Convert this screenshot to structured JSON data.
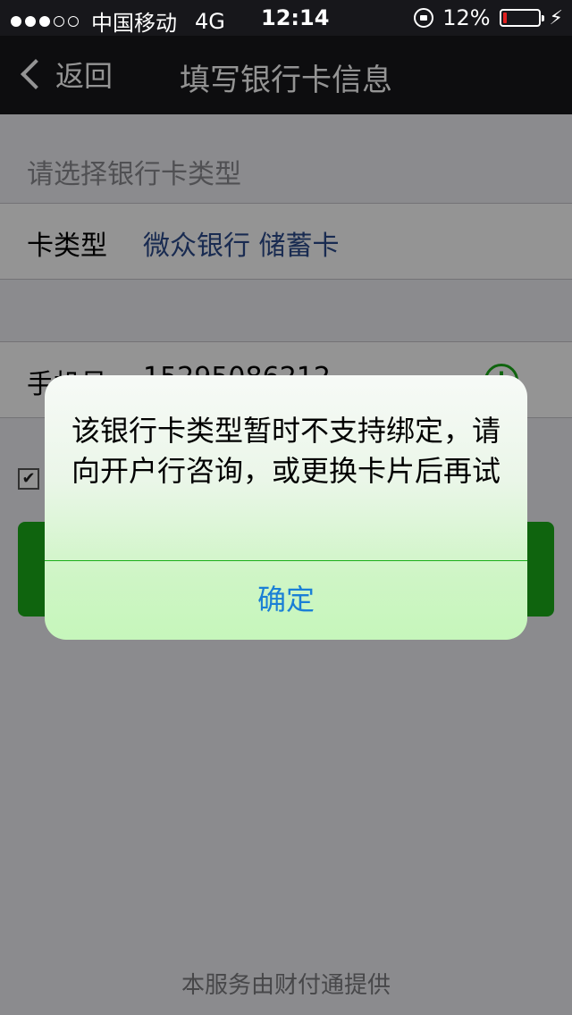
{
  "status_bar": {
    "carrier": "中国移动",
    "network": "4G",
    "time": "12:14",
    "battery_percent": "12%",
    "battery_level": 0.12,
    "signal_bars_filled": 3,
    "signal_bars_total": 5
  },
  "nav": {
    "back_label": "返回",
    "title": "填写银行卡信息"
  },
  "form": {
    "section_hint": "请选择银行卡类型",
    "card_type_label": "卡类型",
    "card_type_value": "微众银行 储蓄卡",
    "phone_label": "手机号",
    "phone_value": "15295086212"
  },
  "agreement_checked": true,
  "footer": "本服务由财付通提供",
  "alert": {
    "message": "该银行卡类型暂时不支持绑定，请向开户行咨询，或更换卡片后再试",
    "confirm": "确定"
  },
  "colors": {
    "accent": "#1aad19",
    "link_blue": "#1a7fd6",
    "card_value_blue": "#2b4b8c",
    "battery_red": "#e02020"
  }
}
